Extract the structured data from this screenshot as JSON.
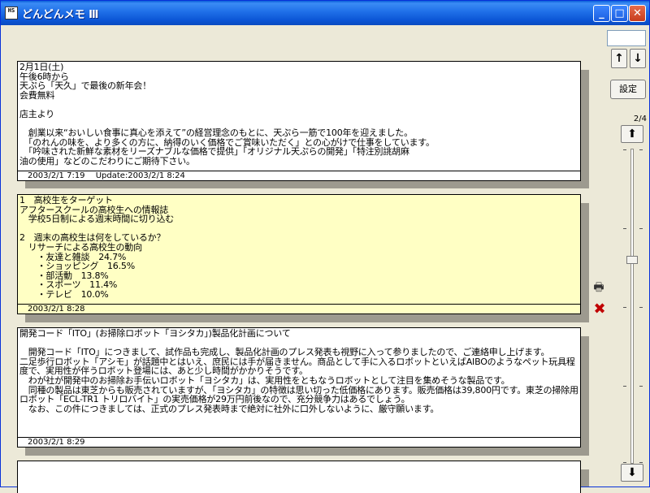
{
  "window": {
    "title": "どんどんメモ Ⅲ",
    "app_icon_text": "HS",
    "minimize": "_",
    "maximize": "□",
    "close": "✕"
  },
  "sidebar": {
    "input_value": "",
    "up_arrow": "↑",
    "down_arrow": "↓",
    "settings_label": "設定",
    "page_indicator": "2/4",
    "nav_up": "⬆",
    "nav_down": "⬇",
    "slider_position": 0.35
  },
  "memos": [
    {
      "text": "2月1日(土)\n午後6時から\n天ぷら「天久」で最後の新年会！\n会費無料\n\n店主より\n\n　創業以来“おいしい食事に真心を添えて”の経営理念のもとに、天ぷら一筋で100年を迎えました。\n　「のれんの味を、より多くの方に、納得のいく価格でご賞味いただく」との心がけで仕事をしています。\n　「吟味された新鮮な素材をリーズナブルな価格で提供」「オリジナル天ぷらの開発」「特注別誂胡麻\n油の使用」などのこだわりにご期待下さい。",
      "footer": "2003/2/1 7:19　 Update:2003/2/1 8:24",
      "color": "#ffffff"
    },
    {
      "text": "1　高校生をターゲット\nアフタースクールの高校生への情報誌\n　学校5日制による週末時間に切り込む\n\n2　週末の高校生は何をしているか？\n　リサーチによる高校生の動向\n　　・友達と雑談　24.7%\n　　・ショッピング　16.5%\n　　・部活動　13.8%\n　　・スポーツ　11.4%\n　　・テレビ　10.0%",
      "footer": "2003/2/1 8:28",
      "color": "#ffffc4"
    },
    {
      "text": "開発コード「ITO」(お掃除ロボット「ヨシタカ」)製品化計画について\n\n　開発コード「ITO」につきまして、試作品も完成し、製品化計画のプレス発表も視野に入って参りましたので、ご連絡申し上げます。\n二足歩行ロボット「アシモ」が話題中とはいえ、庶民には手が届きません。商品として手に入るロボットといえばAIBOのようなペット玩具程度で、実用性が伴うロボット登場には、あと少し時間がかかりそうです。\n　わが社が開発中のお掃除お手伝いロボット「ヨシタカ」は、実用性をともなうロボットとして注目を集めそうな製品です。\n　同種の製品は東芝からも販売されていますが、「ヨシタカ」の特徴は思い切った低価格にあります。販売価格は39,800円です。東芝の掃除用ロボット「ECL-TR1 トリロバイト」の実売価格が29万円前後なので、充分競争力はあるでしょう。\n　なお、この件につきましては、正式のプレス発表時まで絶対に社外に口外しないように、厳守願います。",
      "footer": "2003/2/1 8:29",
      "color": "#ffffff"
    },
    {
      "text": "",
      "footer": "",
      "color": "#ffffff"
    }
  ],
  "icons": {
    "print": "🖶",
    "delete": "✖"
  }
}
